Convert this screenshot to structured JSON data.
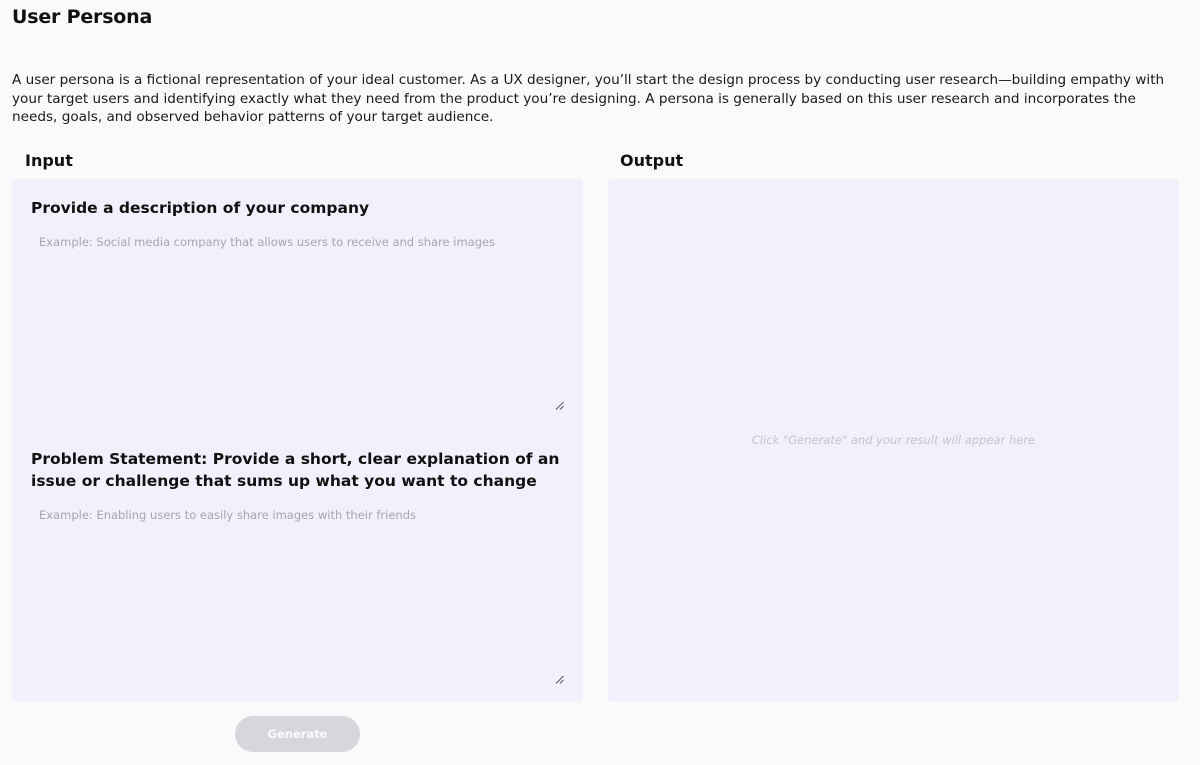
{
  "page": {
    "title": "User Persona",
    "description": "A user persona is a fictional representation of your ideal customer. As a UX designer, you’ll start the design process by conducting user research—building empathy with your target users and identifying exactly what they need from the product you’re designing. A persona is generally based on this user research and incorporates the needs, goals, and observed behavior patterns of your target audience."
  },
  "input": {
    "title": "Input",
    "company": {
      "label": "Provide a description of your company",
      "value": "",
      "placeholder": "Example: Social media company that allows users to receive and share images"
    },
    "problem": {
      "label": "Problem Statement: Provide a short, clear explanation of an issue or challenge that sums up what you want to change",
      "value": "",
      "placeholder": "Example: Enabling users to easily share images with their friends"
    }
  },
  "output": {
    "title": "Output",
    "placeholder": "Click \"Generate\" and your result will appear here"
  },
  "actions": {
    "generate_label": "Generate",
    "generate_enabled": false
  },
  "colors": {
    "panel_background": "#f4effd",
    "page_background": "#fafafa",
    "button_disabled": "#d6d7dc"
  },
  "icons": [
    "resize-handle-icon"
  ]
}
